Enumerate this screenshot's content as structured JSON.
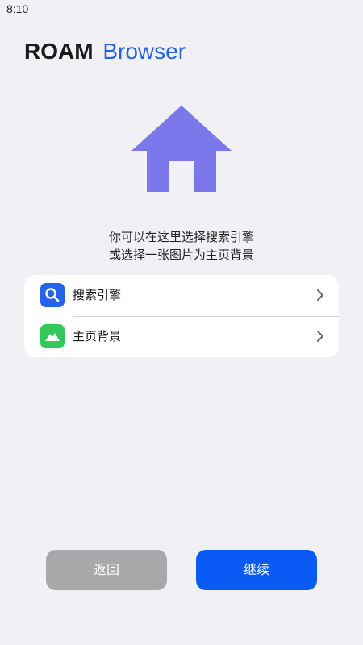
{
  "status_bar": {
    "time": "8:10"
  },
  "header": {
    "title_brand": "ROAM",
    "title_product": "Browser"
  },
  "hero": {
    "icon": "house-icon",
    "color": "#7b78ec"
  },
  "intro": {
    "line1": "你可以在这里选择搜索引擎",
    "line2": "或选择一张图片为主页背景"
  },
  "settings": {
    "items": [
      {
        "label": "搜索引擎",
        "icon": "search-icon",
        "icon_color": "#2563eb"
      },
      {
        "label": "主页背景",
        "icon": "image-icon",
        "icon_color": "#34c759"
      }
    ]
  },
  "footer": {
    "back_label": "返回",
    "continue_label": "继续"
  },
  "colors": {
    "accent": "#0a5bf5",
    "disabled": "#a8a8aa",
    "background": "#f1f1f5"
  }
}
